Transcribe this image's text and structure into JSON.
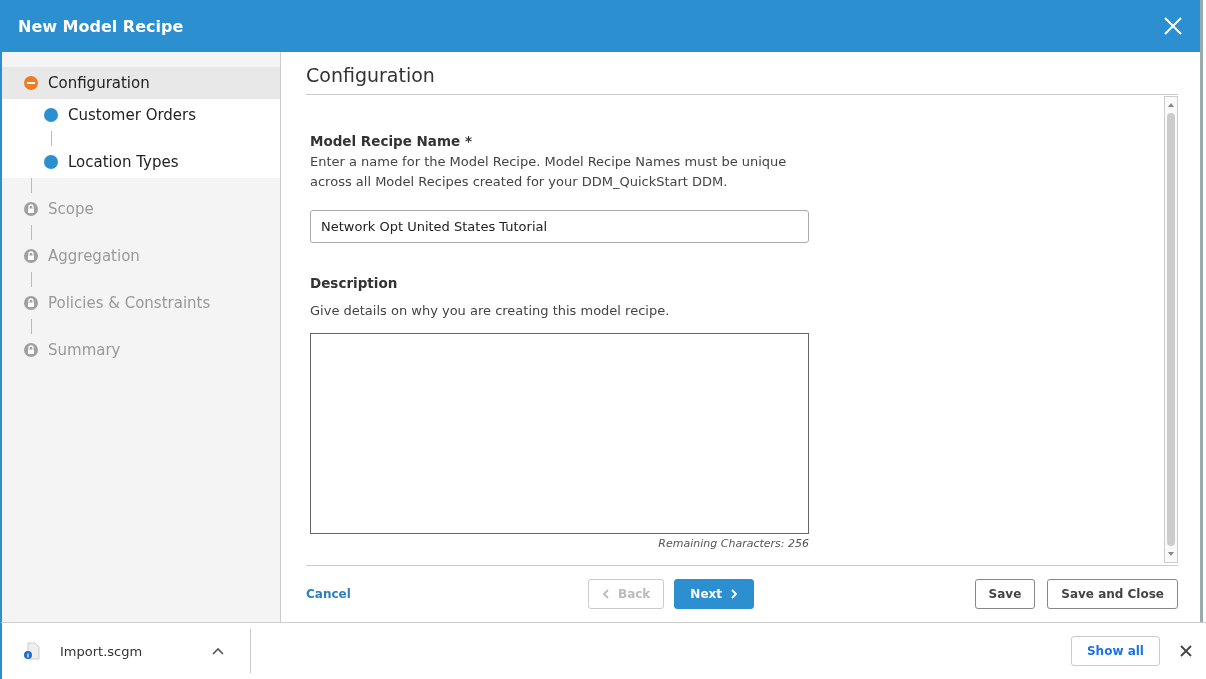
{
  "window": {
    "title": "New Model Recipe"
  },
  "steps": [
    {
      "label": "Configuration",
      "kind": "current",
      "expanded": true,
      "children": [
        {
          "label": "Customer Orders",
          "kind": "substep"
        },
        {
          "label": "Location Types",
          "kind": "substep"
        }
      ]
    },
    {
      "label": "Scope",
      "kind": "locked"
    },
    {
      "label": "Aggregation",
      "kind": "locked"
    },
    {
      "label": "Policies & Constraints",
      "kind": "locked"
    },
    {
      "label": "Summary",
      "kind": "locked"
    }
  ],
  "section_title": "Configuration",
  "name_field": {
    "label": "Model Recipe Name *",
    "help": "Enter a name for the Model Recipe. Model Recipe Names must be unique across all Model Recipes created for your DDM_QuickStart DDM.",
    "value": "Network Opt United States Tutorial"
  },
  "description_field": {
    "label": "Description",
    "help": "Give details on why you are creating this model recipe.",
    "remaining": "Remaining Characters: 256"
  },
  "footer": {
    "cancel": "Cancel",
    "back": {
      "label": "Back",
      "disabled": true
    },
    "next": {
      "label": "Next"
    },
    "save": "Save",
    "save_close": "Save and Close"
  },
  "download_bar": {
    "file": "Import.scgm",
    "show_all": "Show all"
  }
}
